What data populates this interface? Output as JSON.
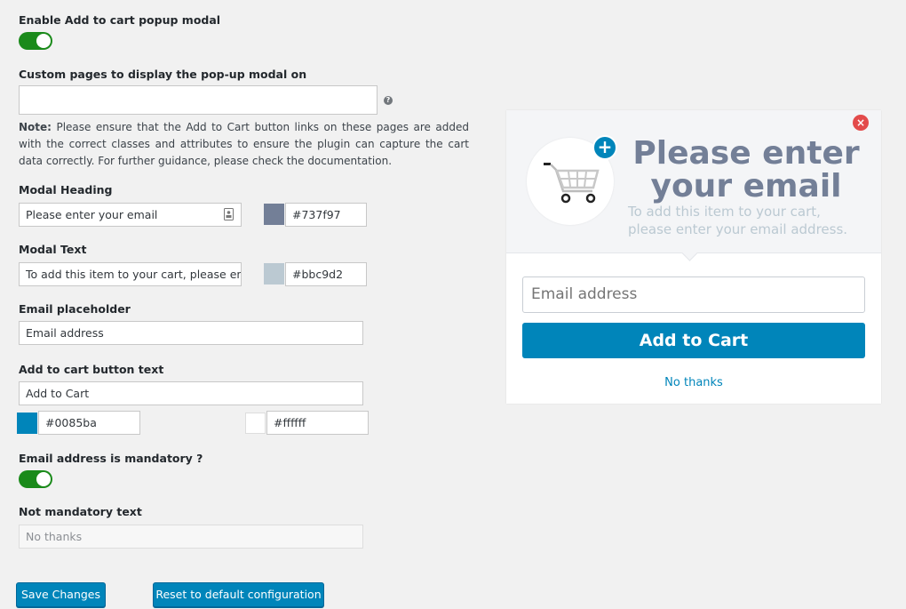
{
  "settings": {
    "enable_label": "Enable Add to cart popup modal",
    "custom_pages_label": "Custom pages to display the pop-up modal on",
    "custom_pages_value": "",
    "help_icon": "?",
    "note_label": "Note:",
    "note_text": " Please ensure that the Add to Cart button links on these pages are added with the correct classes and attributes to ensure the plugin can capture the cart data correctly. For further guidance, please check the documentation.",
    "heading_label": "Modal Heading",
    "heading_value": "Please enter your email",
    "heading_color": "#737f97",
    "text_label": "Modal Text",
    "text_value": "To add this item to your cart, please enter",
    "text_color": "#bbc9d2",
    "placeholder_label": "Email placeholder",
    "placeholder_value": "Email address",
    "button_text_label": "Add to cart button text",
    "button_text_value": "Add to Cart",
    "button_bg_color": "#0085ba",
    "button_text_color": "#ffffff",
    "mandatory_label": "Email address is mandatory ?",
    "not_mandatory_label": "Not mandatory text",
    "not_mandatory_value": "No thanks"
  },
  "actions": {
    "save": "Save Changes",
    "reset": "Reset to default configuration"
  },
  "preview": {
    "close_glyph": "×",
    "plus_glyph": "+",
    "heading": "Please enter your email",
    "text": "To add this item to your cart, please enter your email address.",
    "email_placeholder": "Email address",
    "add_button": "Add to Cart",
    "no_thanks": "No thanks"
  }
}
